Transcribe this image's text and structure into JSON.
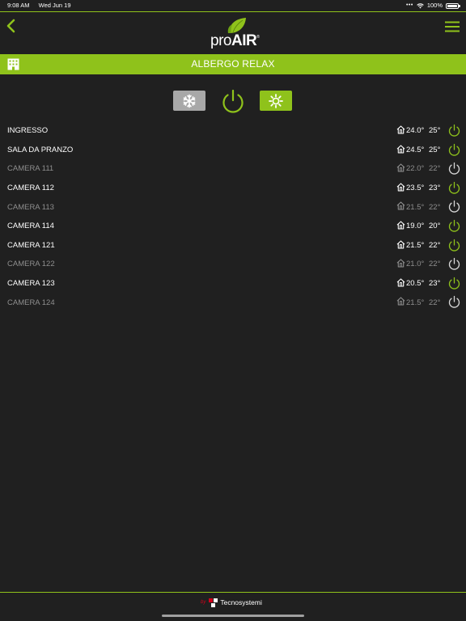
{
  "status_bar": {
    "time": "9:08 AM",
    "date": "Wed Jun 19",
    "battery": "100%"
  },
  "header": {
    "logo_text_pro": "pro",
    "logo_text_air": "AIR",
    "logo_mark": "®",
    "icons": [
      "back-chevron-icon",
      "hamburger-menu-icon",
      "leaf-logo-icon"
    ]
  },
  "location": {
    "title": "ALBERGO RELAX",
    "icon": "building-icon"
  },
  "modes": {
    "cool_icon": "snowflake-icon",
    "heat_icon": "sun-icon",
    "power_icon": "power-icon",
    "heat_active": true
  },
  "zones": [
    {
      "name": "INGRESSO",
      "current": "24.0°",
      "setpoint": "25°",
      "on": true
    },
    {
      "name": "SALA DA PRANZO",
      "current": "24.5°",
      "setpoint": "25°",
      "on": true
    },
    {
      "name": "CAMERA 111",
      "current": "22.0°",
      "setpoint": "22°",
      "on": false
    },
    {
      "name": "CAMERA 112",
      "current": "23.5°",
      "setpoint": "23°",
      "on": true
    },
    {
      "name": "CAMERA 113",
      "current": "21.5°",
      "setpoint": "22°",
      "on": false
    },
    {
      "name": "CAMERA 114",
      "current": "19.0°",
      "setpoint": "20°",
      "on": true
    },
    {
      "name": "CAMERA 121",
      "current": "21.5°",
      "setpoint": "22°",
      "on": true
    },
    {
      "name": "CAMERA 122",
      "current": "21.0°",
      "setpoint": "22°",
      "on": false
    },
    {
      "name": "CAMERA 123",
      "current": "20.5°",
      "setpoint": "23°",
      "on": true
    },
    {
      "name": "CAMERA 124",
      "current": "21.5°",
      "setpoint": "22°",
      "on": false
    }
  ],
  "footer": {
    "by": "by",
    "brand": "Tecnosystemi"
  },
  "colors": {
    "accent": "#8fc21b",
    "background": "#202020",
    "inactive": "#8e8e8e"
  }
}
